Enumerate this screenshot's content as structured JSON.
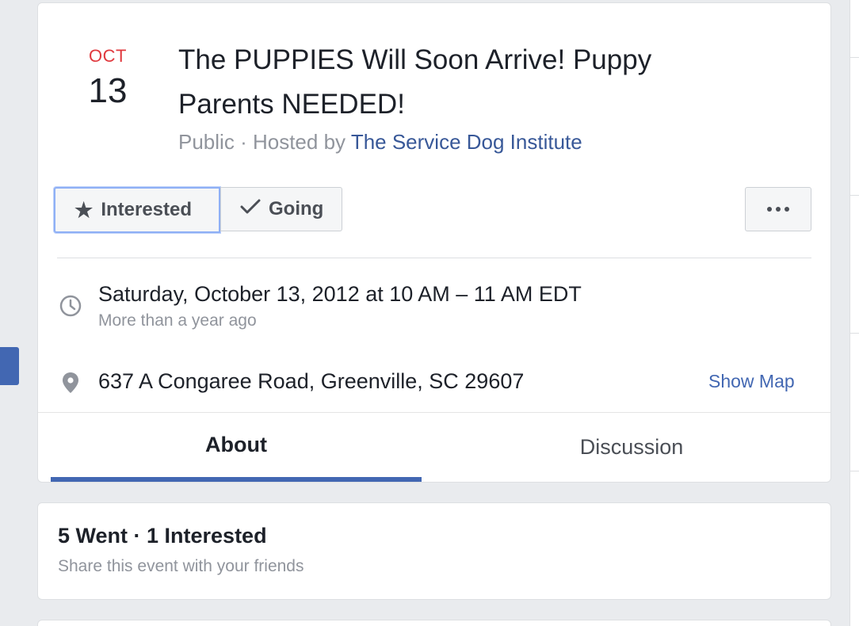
{
  "event": {
    "month": "OCT",
    "day": "13",
    "title": "The PUPPIES Will Soon Arrive! Puppy Parents NEEDED!",
    "privacy": "Public",
    "hosted_by_prefix": "Hosted by",
    "separator": "·",
    "host": "The Service Dog Institute"
  },
  "actions": {
    "interested_label": "Interested",
    "going_label": "Going",
    "more_icon": "ellipsis-icon"
  },
  "details": {
    "datetime": "Saturday, October 13, 2012 at 10 AM – 11 AM EDT",
    "relative_time": "More than a year ago",
    "address": "637 A Congaree Road, Greenville, SC 29607",
    "show_map_label": "Show Map"
  },
  "tabs": [
    {
      "label": "About",
      "active": true
    },
    {
      "label": "Discussion",
      "active": false
    }
  ],
  "stats": {
    "summary": "5 Went · 1 Interested",
    "share_prompt": "Share this event with your friends"
  },
  "colors": {
    "accent": "#4267b2",
    "date_month": "#e0393e",
    "link": "#385898",
    "muted": "#90949c"
  }
}
